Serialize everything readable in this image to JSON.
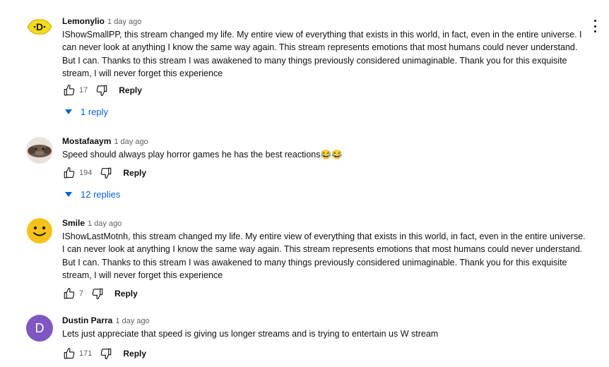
{
  "comments": [
    {
      "author": "Lemonylio",
      "time": "1 day ago",
      "text": "IShowSmallPP, this stream changed my life. My entire view of everything that exists in this world, in fact, even in the entire universe. I can never look at anything I know the same way again. This stream represents emotions that most humans could never understand. But I can. Thanks to this stream I was awakened to many things previously considered unimaginable. Thank you for this exquisite stream, I will never forget this experience",
      "likes": "17",
      "reply_label": "Reply",
      "replies_label": "1 reply",
      "avatar_letter": "D"
    },
    {
      "author": "Mostafaaym",
      "time": "1 day ago",
      "text": "Speed should always play horror games he has the best reactions😂😂",
      "likes": "194",
      "reply_label": "Reply",
      "replies_label": "12 replies"
    },
    {
      "author": "Smile",
      "time": "1 day ago",
      "text": "IShowLastMotnh, this stream changed my life. My entire view of everything that exists in this world, in fact, even in the entire universe. I can never look at anything I know the same way again. This stream represents emotions that most humans could never understand. But I can. Thanks to this stream I was awakened to many things previously considered unimaginable. Thank you for this exquisite stream, I will never forget this experience",
      "likes": "7",
      "reply_label": "Reply"
    },
    {
      "author": "Dustin Parra",
      "time": "1 day ago",
      "text": "Lets just appreciate that speed is giving us longer streams and is trying to entertain us W stream",
      "likes": "171",
      "reply_label": "Reply",
      "avatar_letter": "D"
    }
  ],
  "colors": {
    "link_blue": "#065fd4",
    "muted_text": "#606060",
    "avatar_purple": "#7e57c2",
    "smiley_yellow": "#f6c21a"
  },
  "icons": [
    "thumb-up-icon",
    "thumb-down-icon",
    "caret-down-icon",
    "more-vert-icon"
  ]
}
